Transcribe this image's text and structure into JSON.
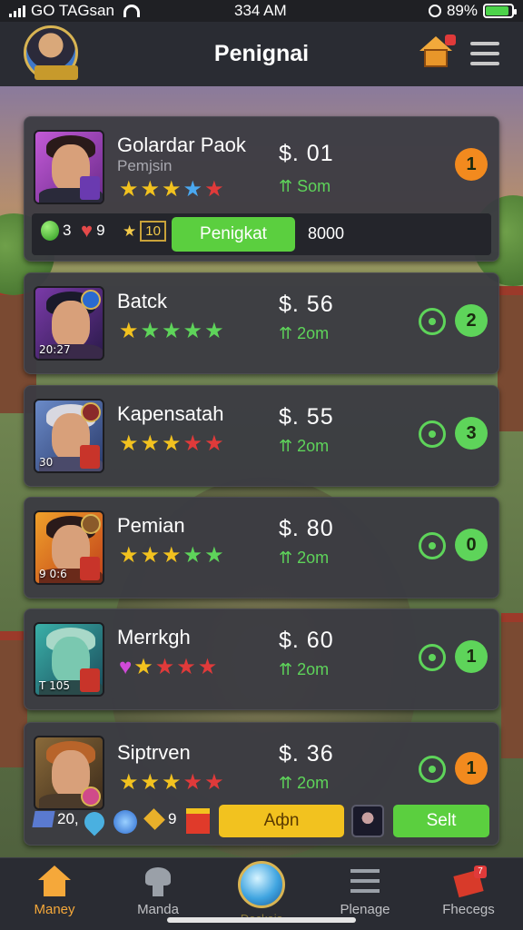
{
  "status_bar": {
    "carrier": "GO TAGsan",
    "time": "334 AM",
    "battery": "89%",
    "battery_level": 0.89
  },
  "header": {
    "title": "Penignai"
  },
  "cards": [
    {
      "name": "Golardar Paok",
      "subtitle": "Pemjsin",
      "price": "$. 01",
      "timer": "Som",
      "rank": "1",
      "stars": [
        "gold",
        "gold",
        "gold",
        "blue",
        "red"
      ],
      "resources": {
        "gems": "3",
        "hearts": "9",
        "coins": "10"
      },
      "action_label": "Penigkat",
      "amount": "8000",
      "rank_color": "#f28a1e"
    },
    {
      "name": "Batck",
      "price": "$. 56",
      "timer": "2om",
      "rank": "2",
      "portrait_caption": "20:27",
      "stars": [
        "gold",
        "green",
        "green",
        "green",
        "green"
      ],
      "rank_color": "#5ed45a"
    },
    {
      "name": "Kapensatah",
      "price": "$. 55",
      "timer": "2om",
      "rank": "3",
      "portrait_caption": "30",
      "stars": [
        "gold",
        "gold",
        "gold",
        "red",
        "red"
      ],
      "rank_color": "#5ed45a"
    },
    {
      "name": "Pemian",
      "price": "$. 80",
      "timer": "2om",
      "rank": "0",
      "portrait_caption": "9 0:6",
      "stars": [
        "gold",
        "gold",
        "gold",
        "green",
        "green"
      ],
      "rank_color": "#5ed45a"
    },
    {
      "name": "Merrkgh",
      "price": "$. 60",
      "timer": "2om",
      "rank": "1",
      "portrait_caption": "T 105",
      "stars": [
        "heart",
        "gold",
        "red",
        "red",
        "red"
      ],
      "rank_color": "#5ed45a"
    },
    {
      "name": "Siptrven",
      "price": "$. 36",
      "timer": "2om",
      "rank": "1",
      "stars": [
        "gold",
        "gold",
        "gold",
        "red",
        "red"
      ],
      "rank_color": "#f28a1e",
      "resources": {
        "blocks": "20,",
        "gold": "9"
      },
      "yellow_label": "Aфn",
      "sell_label": "Selt"
    }
  ],
  "bottom_nav": [
    {
      "label": "Maney",
      "icon": "home-icon",
      "active": true
    },
    {
      "label": "Manda",
      "icon": "mushroom-icon"
    },
    {
      "label": "Deckais",
      "icon": "orb-icon"
    },
    {
      "label": "Plenage",
      "icon": "list-icon"
    },
    {
      "label": "Fhecegs",
      "icon": "gift-icon",
      "badge": "7"
    }
  ]
}
